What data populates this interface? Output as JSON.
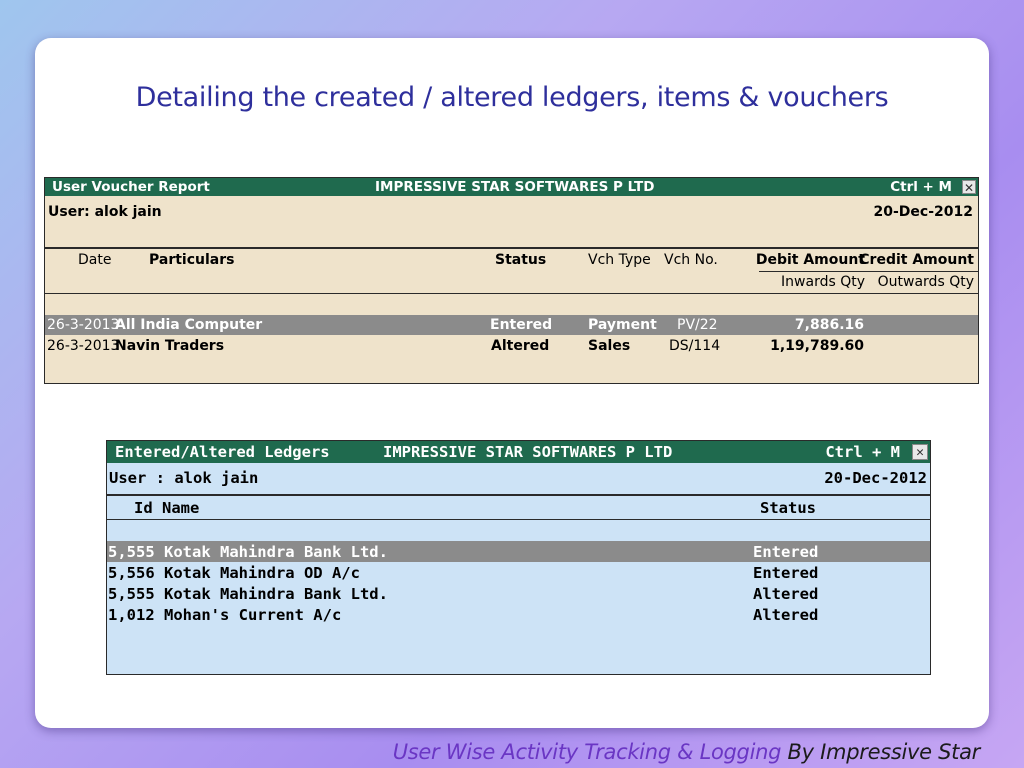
{
  "slide": {
    "title": "Detailing the created / altered ledgers, items & vouchers",
    "footer_accent": "User Wise Activity Tracking & Logging",
    "footer_rest": " By Impressive Star"
  },
  "voucher_window": {
    "title": "User Voucher Report",
    "company": "IMPRESSIVE STAR SOFTWARES P LTD",
    "shortcut": "Ctrl + M",
    "close_symbol": "✕",
    "user": "User: alok jain",
    "date": "20-Dec-2012",
    "headers": {
      "date": "Date",
      "particulars": "Particulars",
      "status": "Status",
      "vch_type": "Vch Type",
      "vch_no": "Vch No.",
      "debit": "Debit Amount",
      "credit": "Credit Amount",
      "inwards": "Inwards Qty",
      "outwards": "Outwards Qty"
    },
    "rows": [
      {
        "date": "26-3-2013",
        "particulars": "All India Computer",
        "status": "Entered",
        "vch_type": "Payment",
        "vch_no": "PV/22",
        "debit": "7,886.16"
      },
      {
        "date": "26-3-2013",
        "particulars": "Navin Traders",
        "status": "Altered",
        "vch_type": "Sales",
        "vch_no": "DS/114",
        "debit": "1,19,789.60"
      }
    ]
  },
  "ledger_window": {
    "title": "Entered/Altered Ledgers",
    "company": "IMPRESSIVE STAR SOFTWARES P LTD",
    "shortcut": "Ctrl + M",
    "close_symbol": "✕",
    "user": "User : alok jain",
    "date": "20-Dec-2012",
    "headers": {
      "id_name": "Id Name",
      "status": "Status"
    },
    "rows": [
      {
        "id_name": "5,555 Kotak Mahindra Bank Ltd.",
        "status": "Entered"
      },
      {
        "id_name": "5,556 Kotak Mahindra OD A/c",
        "status": "Entered"
      },
      {
        "id_name": "5,555 Kotak Mahindra Bank Ltd.",
        "status": "Altered"
      },
      {
        "id_name": "1,012 Mohan's Current A/c",
        "status": "Altered"
      }
    ]
  },
  "colors": {
    "title_bar": "#1f6a4e",
    "voucher_bg": "#efe3cb",
    "ledger_bg": "#cde3f6",
    "selected_row": "#8b8b8b",
    "slide_title": "#2e2f9c",
    "footer_accent": "#6a36c4"
  }
}
